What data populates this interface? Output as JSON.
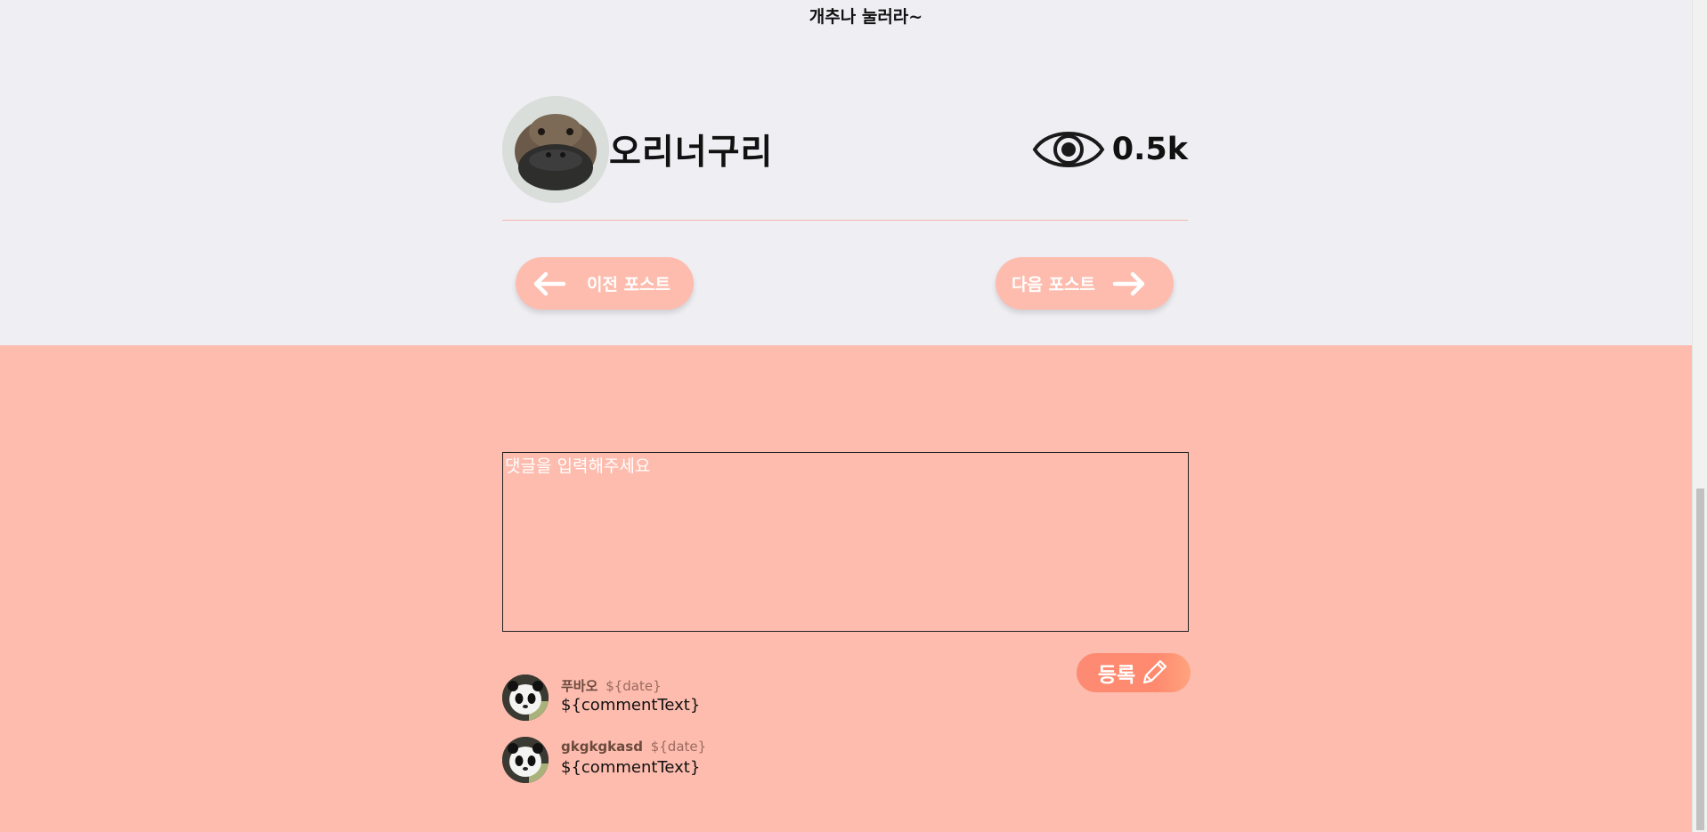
{
  "top_caption": "개추나 눌러라~",
  "post": {
    "author_name": "오리너구리",
    "views_count": "0.5k",
    "icons": {
      "avatar": "platypus-avatar",
      "views": "eye-icon"
    }
  },
  "navigation": {
    "prev_label": "이전 포스트",
    "next_label": "다음 포스트"
  },
  "comment_form": {
    "placeholder": "댓글을 입력해주세요",
    "value": "",
    "submit_label": "등록",
    "submit_icon": "pencil-icon"
  },
  "comments": [
    {
      "author": "푸바오",
      "date": "${date}",
      "text": "${commentText}",
      "avatar": "panda-avatar"
    },
    {
      "author": "gkgkgkasd",
      "date": "${date}",
      "text": "${commentText}",
      "avatar": "panda-avatar"
    }
  ],
  "colors": {
    "page_bg": "#efeef3",
    "comment_section_bg": "#fdbcae",
    "nav_button_bg": "#fdbcad",
    "submit_button_bg": "#ff8a6f",
    "divider": "#f6b8ad"
  }
}
